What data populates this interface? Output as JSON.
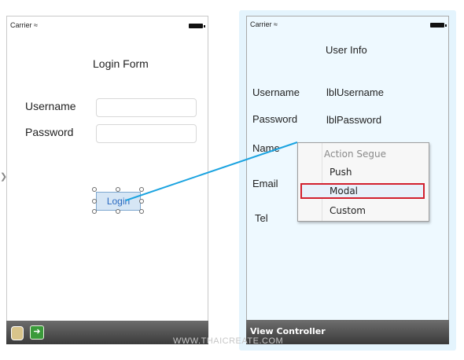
{
  "left_scene": {
    "status_carrier": "Carrier",
    "title": "Login Form",
    "username_label": "Username",
    "password_label": "Password",
    "login_button": "Login"
  },
  "right_scene": {
    "status_carrier": "Carrier",
    "title": "User Info",
    "username_label": "Username",
    "username_value": "lblUsername",
    "password_label": "Password",
    "password_value": "lblPassword",
    "name_label": "Name",
    "email_label": "Email",
    "tel_label": "Tel",
    "toolbar_label": "View Controller"
  },
  "segue_menu": {
    "header": "Action Segue",
    "items": [
      "Push",
      "Modal",
      "Custom"
    ],
    "selected": "Modal"
  },
  "watermark": "WWW.THAICREATE.COM",
  "colors": {
    "connection_line": "#1aa3e0",
    "selection_outline": "#d2202e",
    "right_scene_background": "#eef9ff"
  }
}
